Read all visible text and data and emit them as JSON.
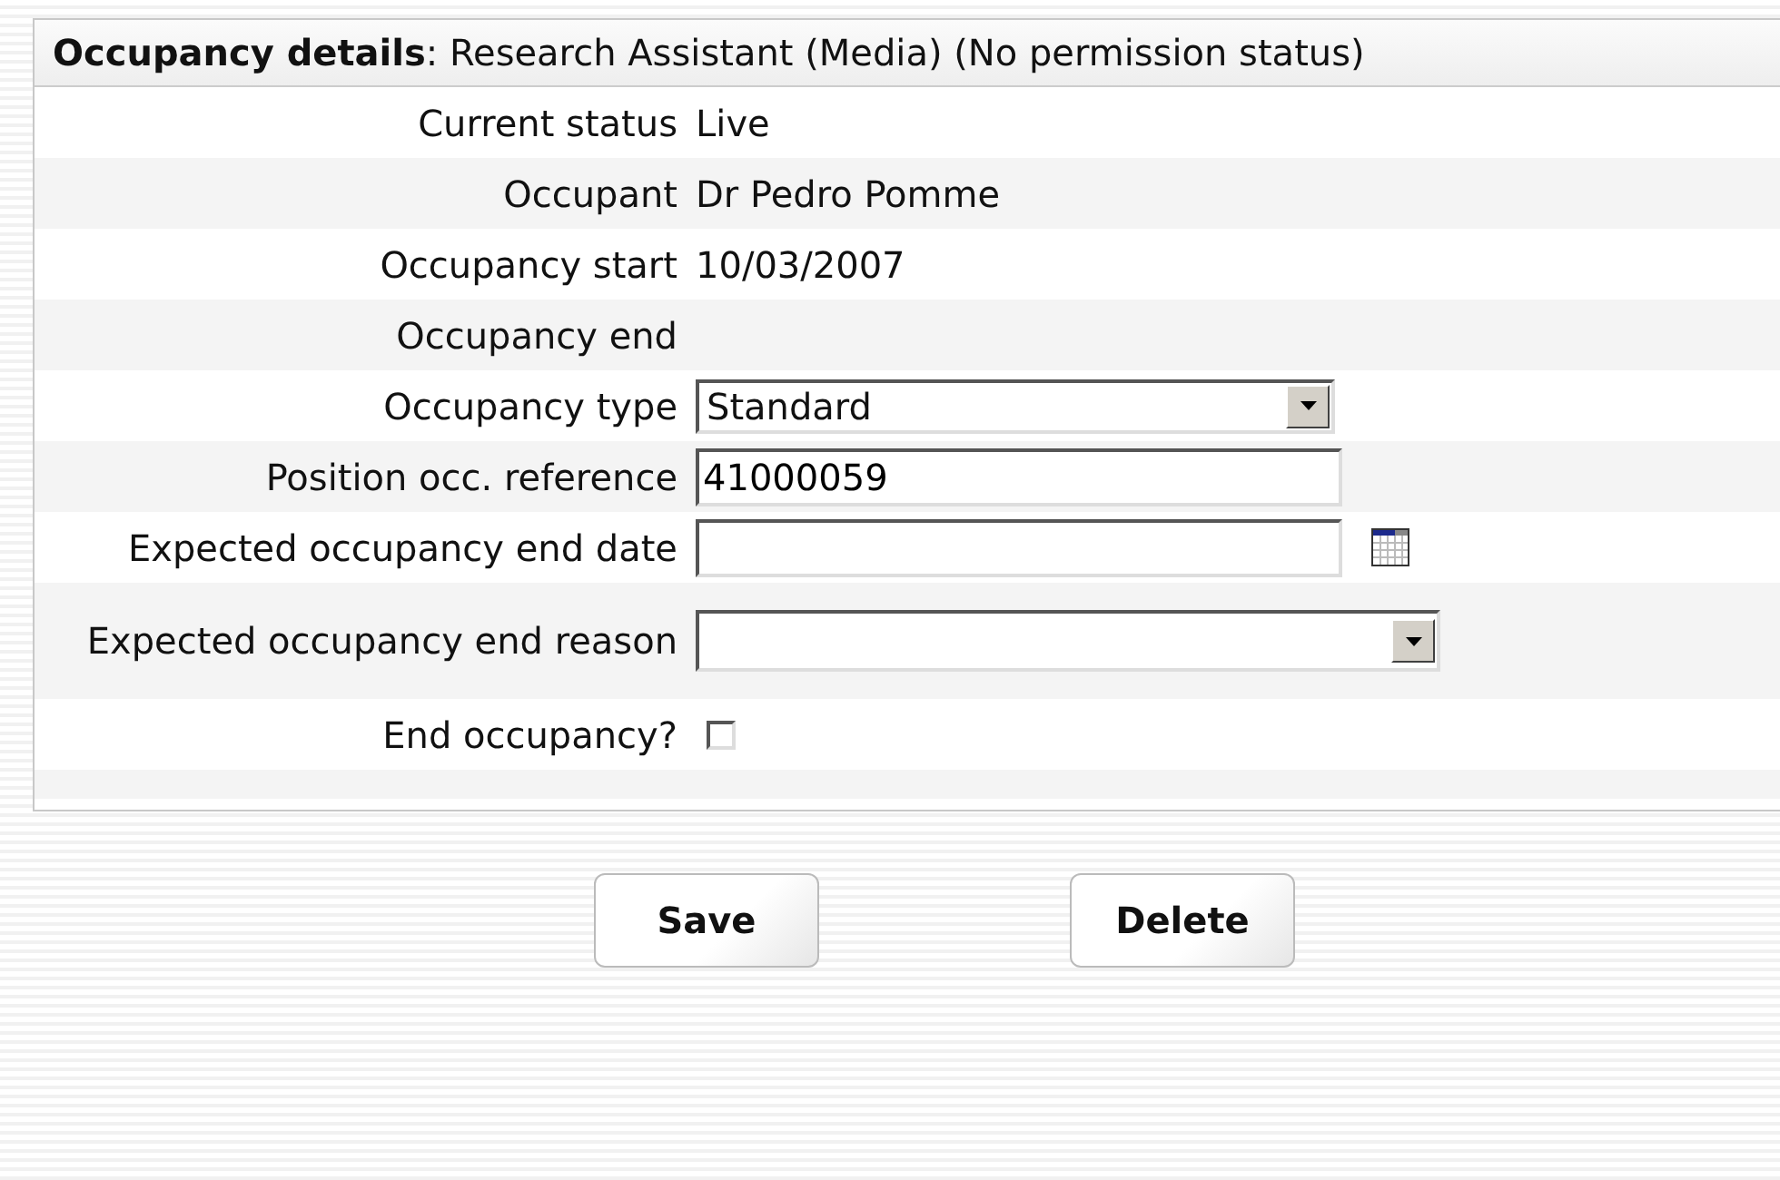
{
  "panel": {
    "title_bold": "Occupancy details",
    "title_rest": ": Research Assistant (Media) (No permission status)"
  },
  "rows": [
    {
      "kind": "text",
      "label": "Current status",
      "value": "Live"
    },
    {
      "kind": "text",
      "label": "Occupant",
      "value": "Dr Pedro Pomme"
    },
    {
      "kind": "text",
      "label": "Occupancy start",
      "value": "10/03/2007"
    },
    {
      "kind": "text",
      "label": "Occupancy end"
    },
    {
      "kind": "select",
      "label": "Occupancy type",
      "value": "Standard"
    },
    {
      "kind": "input",
      "label": "Position occ. reference",
      "value": "41000059"
    },
    {
      "kind": "date",
      "label": "Expected occupancy end date"
    },
    {
      "kind": "select-wide",
      "label": "Expected occupancy end reason"
    },
    {
      "kind": "checkbox",
      "label": "End occupancy?",
      "checked": false
    }
  ],
  "buttons": [
    "Save",
    "Delete"
  ]
}
